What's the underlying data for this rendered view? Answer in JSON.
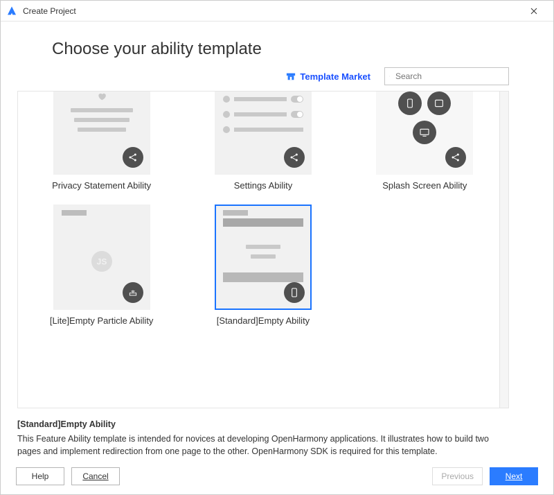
{
  "window": {
    "title": "Create Project"
  },
  "page": {
    "heading": "Choose your ability template",
    "market_link": "Template Market",
    "search_placeholder": "Search"
  },
  "templates": {
    "row1": [
      {
        "label": "Privacy Statement Ability"
      },
      {
        "label": "Settings Ability"
      },
      {
        "label": "Splash Screen Ability"
      }
    ],
    "row2": [
      {
        "label": "[Lite]Empty Particle Ability"
      },
      {
        "label": "[Standard]Empty Ability"
      }
    ]
  },
  "description": {
    "title": "[Standard]Empty Ability",
    "body": "This Feature Ability template is intended for novices at developing OpenHarmony applications. It illustrates how to build two pages and implement redirection from one page to the other. OpenHarmony SDK is required for this template."
  },
  "footer": {
    "help": "Help",
    "cancel": "Cancel",
    "previous": "Previous",
    "next": "Next"
  }
}
